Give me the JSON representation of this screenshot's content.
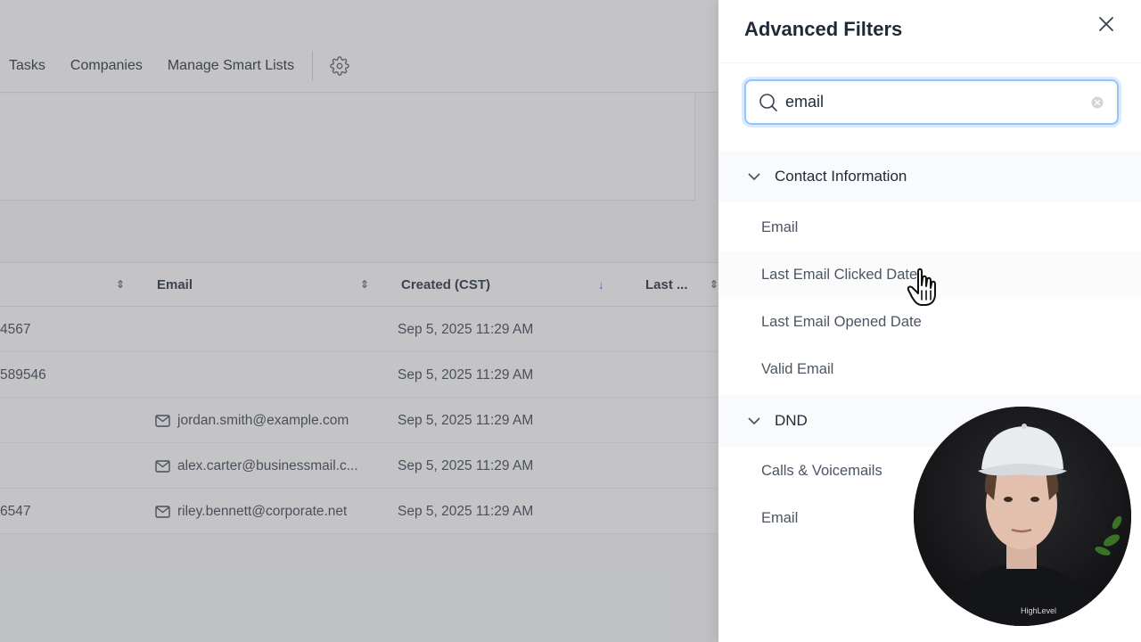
{
  "nav": {
    "items": [
      "Tasks",
      "Companies",
      "Manage Smart Lists"
    ],
    "gear_icon": "gear-icon"
  },
  "table": {
    "headers": {
      "email": "Email",
      "created": "Created (CST)",
      "last": "Last ..."
    },
    "rows": [
      {
        "phone": "4567",
        "email": "",
        "created": "Sep 5, 2025 11:29 AM"
      },
      {
        "phone": "589546",
        "email": "",
        "created": "Sep 5, 2025 11:29 AM"
      },
      {
        "phone": "",
        "email": "jordan.smith@example.com",
        "created": "Sep 5, 2025 11:29 AM"
      },
      {
        "phone": "",
        "email": "alex.carter@businessmail.c...",
        "created": "Sep 5, 2025 11:29 AM"
      },
      {
        "phone": "6547",
        "email": "riley.bennett@corporate.net",
        "created": "Sep 5, 2025 11:29 AM"
      }
    ]
  },
  "panel": {
    "title": "Advanced Filters",
    "search": {
      "value": "email",
      "placeholder": ""
    },
    "groups": [
      {
        "label": "Contact Information",
        "options": [
          "Email",
          "Last Email Clicked Date",
          "Last Email Opened Date",
          "Valid Email"
        ]
      },
      {
        "label": "DND",
        "options": [
          "Calls & Voicemails",
          "Email"
        ]
      }
    ]
  },
  "webcam": {
    "shirt_text": "HighLevel"
  },
  "colors": {
    "accent": "#3b82f6",
    "focus_ring": "#93c5fd",
    "panel_bg": "#ffffff",
    "group_bg": "#f9fafb"
  }
}
